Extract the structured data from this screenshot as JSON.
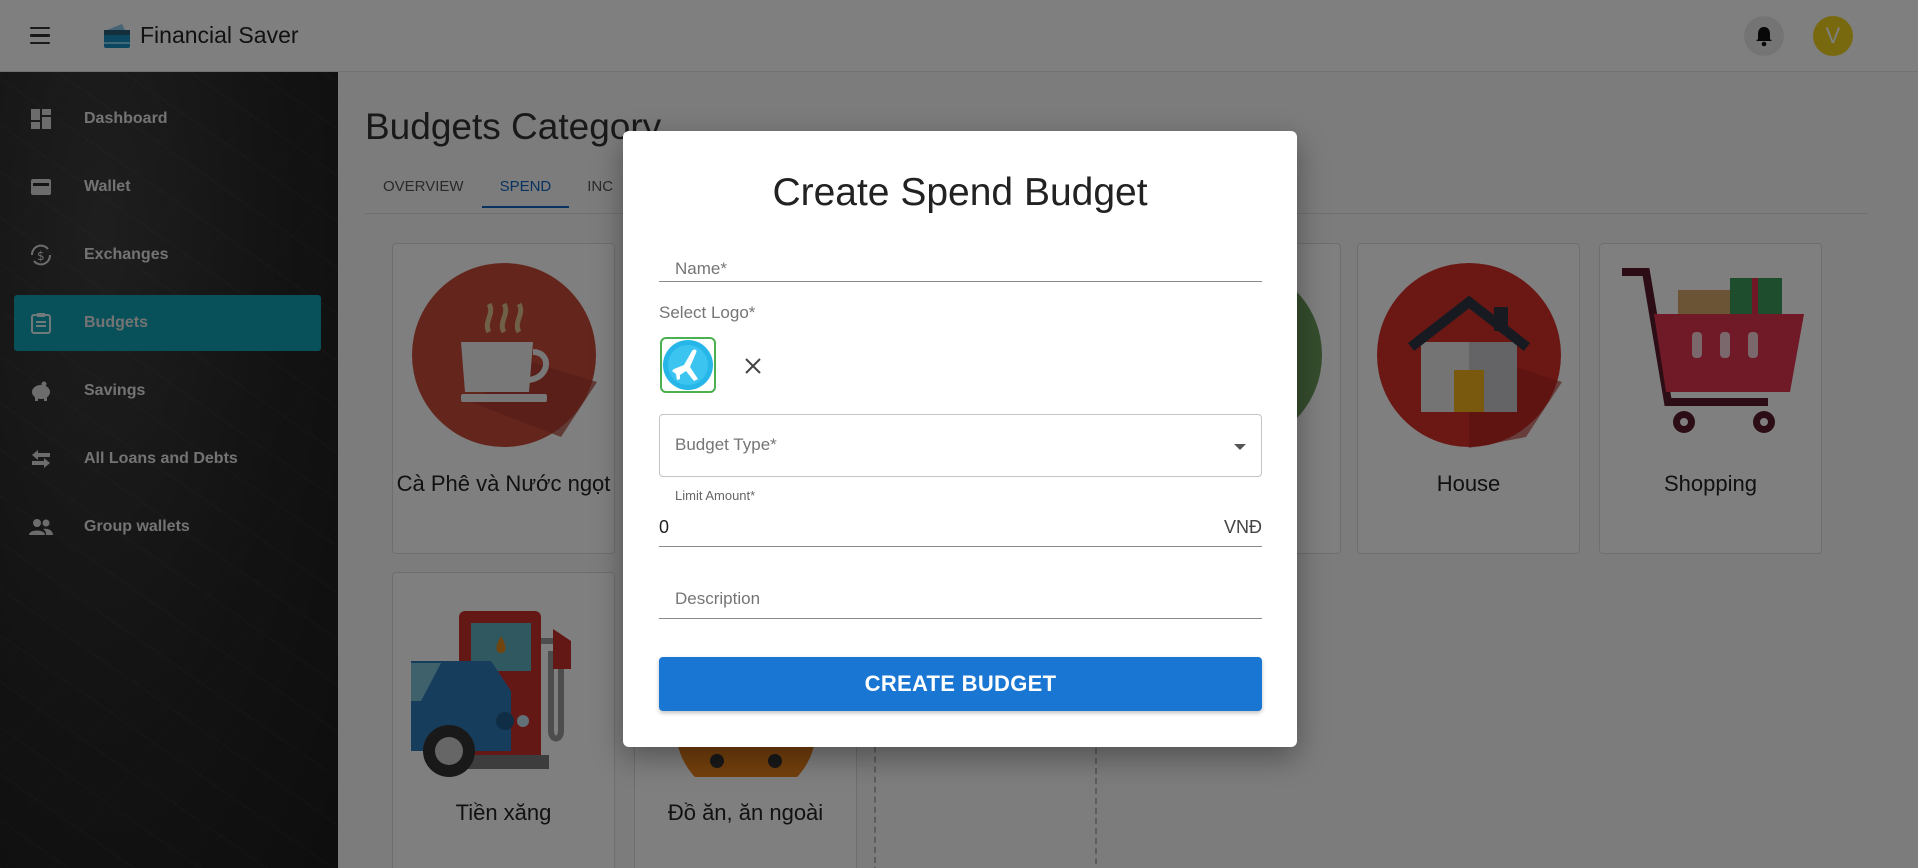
{
  "app": {
    "title": "Financial Saver",
    "avatar_initial": "V"
  },
  "sidebar": {
    "items": [
      {
        "label": "Dashboard",
        "icon": "dashboard-icon"
      },
      {
        "label": "Wallet",
        "icon": "wallet-icon"
      },
      {
        "label": "Exchanges",
        "icon": "exchange-icon"
      },
      {
        "label": "Budgets",
        "icon": "budget-icon",
        "active": true
      },
      {
        "label": "Savings",
        "icon": "piggy-bank-icon"
      },
      {
        "label": "All Loans and Debts",
        "icon": "swap-arrows-icon"
      },
      {
        "label": "Group wallets",
        "icon": "group-icon"
      }
    ],
    "active_color": "#10a2b4"
  },
  "main": {
    "title": "Budgets Category",
    "tabs": [
      {
        "label": "Overview"
      },
      {
        "label": "Spend",
        "active": true
      },
      {
        "label": "Inc"
      }
    ],
    "cards": [
      {
        "label": "Cà Phê và Nước ngọt",
        "icon": "coffee-cup-icon"
      },
      {
        "label": "House",
        "icon": "house-icon"
      },
      {
        "label": "Shopping",
        "icon": "shopping-cart-icon"
      },
      {
        "label": "Tiền xăng",
        "icon": "gas-station-icon"
      },
      {
        "label": "Đồ ăn, ăn ngoài",
        "icon": "food-icon"
      }
    ]
  },
  "dialog": {
    "title": "Create Spend Budget",
    "name_placeholder": "Name*",
    "select_logo_label": "Select Logo*",
    "selected_logo_icon": "airplane-icon",
    "budget_type_placeholder": "Budget Type*",
    "limit_amount_label": "Limit Amount*",
    "limit_amount_value": "0",
    "currency": "VNĐ",
    "description_placeholder": "Description",
    "submit_label": "CREATE BUDGET"
  },
  "colors": {
    "primary": "#1976d2",
    "accent": "#10a2b4",
    "avatar": "#f0d21d"
  }
}
